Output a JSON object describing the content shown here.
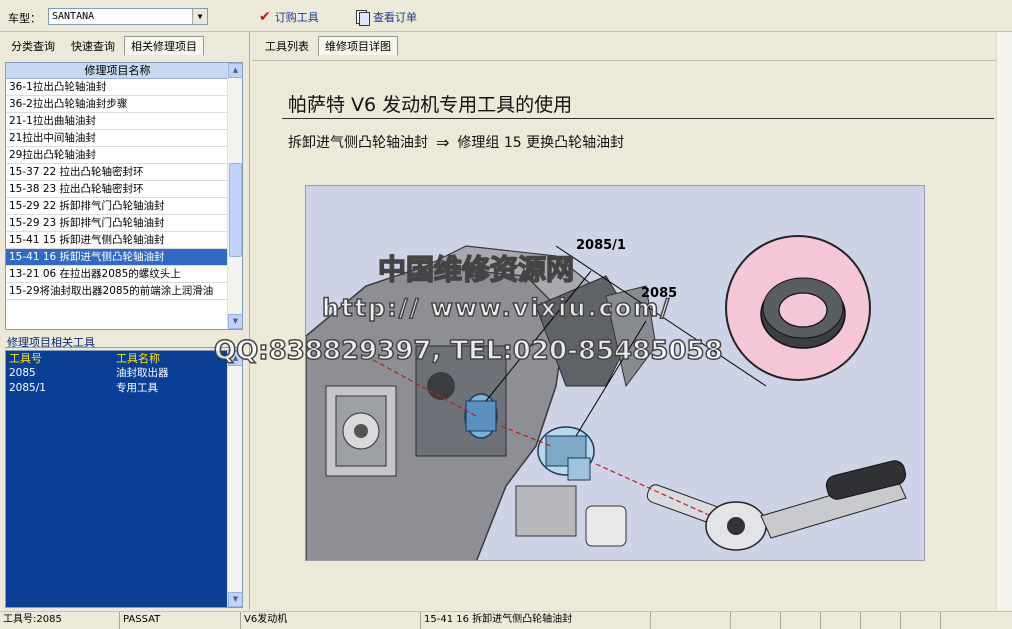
{
  "toolbar": {
    "car_label": "车型：",
    "car_value": "SANTANA",
    "order_tools_label": "订购工具",
    "view_orders_label": "查看订单"
  },
  "left_tabs": [
    "分类查询",
    "快速查询",
    "相关修理项目"
  ],
  "repair_list": {
    "header": "修理项目名称",
    "items": [
      "36-1拉出凸轮轴油封",
      "36-2拉出凸轮轴油封步骤",
      "21-1拉出曲轴油封",
      "21拉出中间轴油封",
      "29拉出凸轮轴油封",
      "15-37 22 拉出凸轮轴密封环",
      "15-38 23 拉出凸轮轴密封环",
      "15-29 22 拆卸排气门凸轮轴油封",
      "15-29 23 拆卸排气门凸轮轴油封",
      "15-41 15 拆卸进气侧凸轮轴油封",
      "15-41 16 拆卸进气侧凸轮轴油封",
      "13-21 06 在拉出器2085的螺纹头上",
      "15-29将油封取出器2085的前端涂上润滑油"
    ],
    "selected_index": 10
  },
  "tools": {
    "section_title": "修理项目相关工具",
    "col_no": "工具号",
    "col_name": "工具名称",
    "rows": [
      {
        "no": "2085",
        "name": "油封取出器"
      },
      {
        "no": "2085/1",
        "name": "专用工具"
      }
    ]
  },
  "right_tabs": [
    "工具列表",
    "维修项目详图"
  ],
  "detail": {
    "title": "帕萨特 V6 发动机专用工具的使用",
    "subtitle_left": "拆卸进气侧凸轮轴油封",
    "subtitle_arrow": "⇒",
    "subtitle_right": "修理组 15  更换凸轮轴油封",
    "callout_1": "2085/1",
    "callout_2": "2085",
    "watermark_1": "中国维修资源网",
    "watermark_2": "http:// www.vixiu.com/",
    "watermark_3": "QQ:838829397, TEL:020-85485058"
  },
  "statusbar": {
    "tool_no": "工具号:2085",
    "model": "PASSAT",
    "engine": "V6发动机",
    "item": "15-41 16 拆卸进气侧凸轮轴油封"
  },
  "colors": {
    "selection": "#316ac5",
    "tools_bg": "#0a3f98",
    "tools_header": "#ffe600",
    "diagram_bg": "#cfd3e7",
    "inset_bg": "#f4c6d7"
  }
}
